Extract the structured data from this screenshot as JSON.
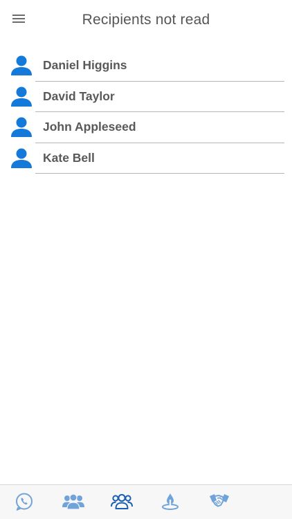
{
  "header": {
    "title": "Recipients not read",
    "menu_icon": "hamburger-menu-icon"
  },
  "recipients": [
    {
      "name": "Daniel Higgins",
      "icon": "person-icon"
    },
    {
      "name": "David Taylor",
      "icon": "person-icon"
    },
    {
      "name": "John Appleseed",
      "icon": "person-icon"
    },
    {
      "name": "Kate Bell",
      "icon": "person-icon"
    }
  ],
  "tabbar": {
    "tabs": [
      {
        "icon": "phone-chat-icon",
        "active": false
      },
      {
        "icon": "group-icon",
        "active": false
      },
      {
        "icon": "group-outline-icon",
        "active": true
      },
      {
        "icon": "candle-icon",
        "active": false
      },
      {
        "icon": "handshake-icon",
        "active": false
      }
    ]
  },
  "colors": {
    "accent": "#1479d8",
    "tab_inactive": "#6fa3d9",
    "tab_active": "#1a5fb4",
    "text": "#595959",
    "divider": "#b5b5b5"
  }
}
